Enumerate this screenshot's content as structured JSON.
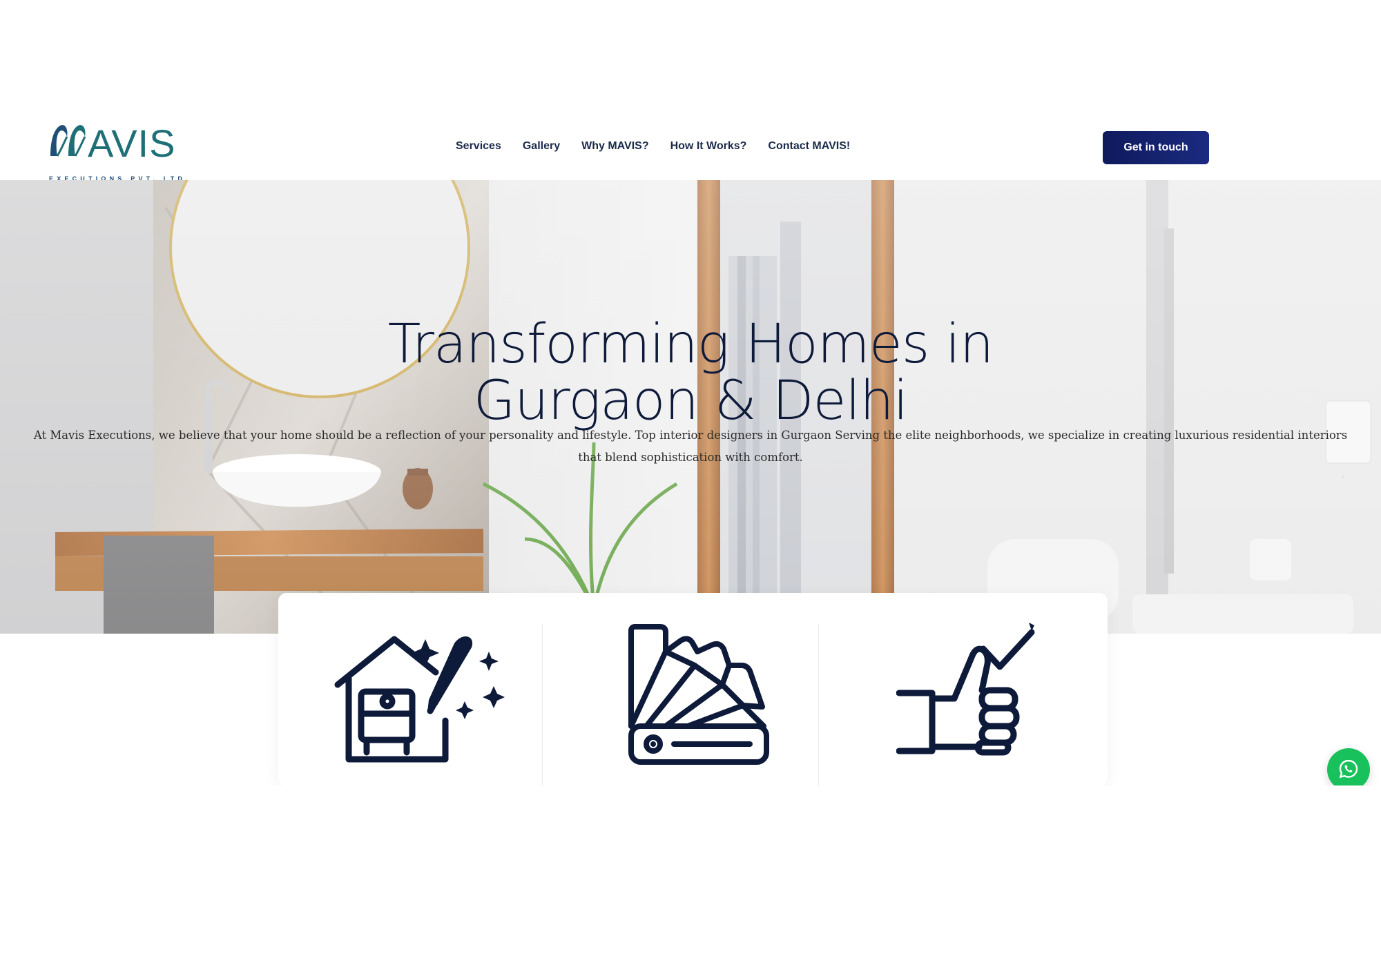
{
  "logo": {
    "wordmark": "AVIS",
    "subtitle": "EXECUTIONS PVT. LTD."
  },
  "nav": {
    "items": [
      "Services",
      "Gallery",
      "Why MAVIS?",
      "How It Works?",
      "Contact MAVIS!"
    ]
  },
  "header": {
    "cta_label": "Get in touch"
  },
  "hero": {
    "title_line1": "Transforming Homes in",
    "title_line2": "Gurgaon & Delhi",
    "description": "At Mavis Executions, we believe that your home should be a reflection of your personality and lifestyle. Top interior designers in Gurgaon Serving the elite neighborhoods, we specialize in creating luxurious residential interiors that blend sophistication with comfort."
  },
  "features": [
    {
      "icon": "interior-design-icon"
    },
    {
      "icon": "color-palette-icon"
    },
    {
      "icon": "thumbs-up-check-icon"
    }
  ],
  "floating": {
    "icon": "whatsapp-icon"
  },
  "colors": {
    "brand_teal": "#1f6f76",
    "navy": "#0e1a3a",
    "cta": "#0f1a5c",
    "whatsapp": "#19c15c"
  }
}
